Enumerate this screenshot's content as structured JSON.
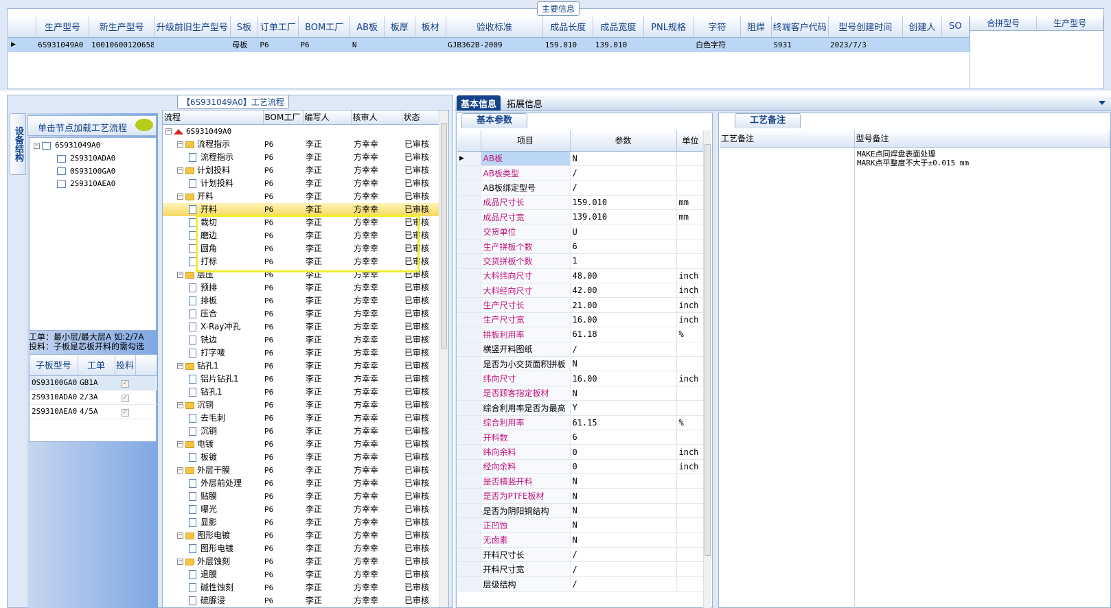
{
  "main_info": {
    "caption": "主要信息",
    "columns": [
      "生产型号",
      "新生产型号",
      "升级前旧生产型号",
      "S板",
      "订单工厂",
      "BOM工厂",
      "AB板",
      "板厚",
      "板材",
      "验收标准",
      "成品长度",
      "成品宽度",
      "PNL规格",
      "字符",
      "阻焊",
      "终端客户代码",
      "型号创建时间",
      "创建人",
      "SO"
    ],
    "row": [
      "6S931049A0",
      "10010600120658",
      "",
      "母板",
      "P6",
      "P6",
      "N",
      "",
      "",
      "GJB362B-2009",
      "159.010",
      "139.010",
      "",
      "白色字符",
      "",
      "S931",
      "2023/7/3",
      "",
      ""
    ],
    "merge_cols": [
      "合拼型号",
      "生产型号"
    ]
  },
  "process": {
    "caption": "【6S931049A0】工艺流程",
    "side_tab": "设备结构",
    "hint": "单击节点加载工艺流程",
    "left_tree": {
      "root": "6S931049A0",
      "children": [
        "2S9310ADA0",
        "0S93100GA0",
        "2S9310AEA0"
      ]
    },
    "note_line1": "工单：最小层/最大层A 如:2/7A",
    "note_line2": "投料：子板是芯板开料的需勾选",
    "sub_columns": [
      "子板型号",
      "工单",
      "投料"
    ],
    "sub_rows": [
      [
        "0S93100GA0",
        "GB1A"
      ],
      [
        "2S9310ADA0",
        "2/3A"
      ],
      [
        "2S9310AEA0",
        "4/5A"
      ]
    ],
    "tree_columns": [
      "流程",
      "BOM工厂",
      "编写人",
      "核审人",
      "状态"
    ],
    "tree_rows": [
      {
        "label": "6S931049A0",
        "level": 0,
        "kind": "root",
        "bom": "",
        "writer": "",
        "reviewer": "",
        "status": ""
      },
      {
        "label": "流程指示",
        "level": 1,
        "kind": "folder",
        "bom": "P6",
        "writer": "李正",
        "reviewer": "方幸幸",
        "status": "已审核"
      },
      {
        "label": "流程指示",
        "level": 2,
        "kind": "doc",
        "bom": "P6",
        "writer": "李正",
        "reviewer": "方幸幸",
        "status": "已审核"
      },
      {
        "label": "计划投料",
        "level": 1,
        "kind": "folder",
        "bom": "P6",
        "writer": "李正",
        "reviewer": "方幸幸",
        "status": "已审核"
      },
      {
        "label": "计划投料",
        "level": 2,
        "kind": "doc",
        "bom": "P6",
        "writer": "李正",
        "reviewer": "方幸幸",
        "status": "已审核"
      },
      {
        "label": "开料",
        "level": 1,
        "kind": "folder",
        "bom": "P6",
        "writer": "李正",
        "reviewer": "方幸幸",
        "status": "已审核"
      },
      {
        "label": "开料",
        "level": 2,
        "kind": "doc",
        "bom": "P6",
        "writer": "李正",
        "reviewer": "方幸幸",
        "status": "已审核",
        "selected": true
      },
      {
        "label": "裁切",
        "level": 2,
        "kind": "doc",
        "bom": "P6",
        "writer": "李正",
        "reviewer": "方幸幸",
        "status": "已审核"
      },
      {
        "label": "磨边",
        "level": 2,
        "kind": "doc",
        "bom": "P6",
        "writer": "李正",
        "reviewer": "方幸幸",
        "status": "已审核"
      },
      {
        "label": "圆角",
        "level": 2,
        "kind": "doc",
        "bom": "P6",
        "writer": "李正",
        "reviewer": "方幸幸",
        "status": "已审核"
      },
      {
        "label": "打标",
        "level": 2,
        "kind": "doc",
        "bom": "P6",
        "writer": "李正",
        "reviewer": "方幸幸",
        "status": "已审核"
      },
      {
        "label": "层压",
        "level": 1,
        "kind": "folder",
        "bom": "P6",
        "writer": "李正",
        "reviewer": "方幸幸",
        "status": "已审核"
      },
      {
        "label": "预排",
        "level": 2,
        "kind": "doc",
        "bom": "P6",
        "writer": "李正",
        "reviewer": "方幸幸",
        "status": "已审核"
      },
      {
        "label": "排板",
        "level": 2,
        "kind": "doc",
        "bom": "P6",
        "writer": "李正",
        "reviewer": "方幸幸",
        "status": "已审核"
      },
      {
        "label": "压合",
        "level": 2,
        "kind": "doc",
        "bom": "P6",
        "writer": "李正",
        "reviewer": "方幸幸",
        "status": "已审核"
      },
      {
        "label": "X-Ray冲孔",
        "level": 2,
        "kind": "doc",
        "bom": "P6",
        "writer": "李正",
        "reviewer": "方幸幸",
        "status": "已审核"
      },
      {
        "label": "铣边",
        "level": 2,
        "kind": "doc",
        "bom": "P6",
        "writer": "李正",
        "reviewer": "方幸幸",
        "status": "已审核"
      },
      {
        "label": "打字唛",
        "level": 2,
        "kind": "doc",
        "bom": "P6",
        "writer": "李正",
        "reviewer": "方幸幸",
        "status": "已审核"
      },
      {
        "label": "钻孔1",
        "level": 1,
        "kind": "folder",
        "bom": "P6",
        "writer": "李正",
        "reviewer": "方幸幸",
        "status": "已审核"
      },
      {
        "label": "铝片钻孔1",
        "level": 2,
        "kind": "doc",
        "bom": "P6",
        "writer": "李正",
        "reviewer": "方幸幸",
        "status": "已审核"
      },
      {
        "label": "钻孔1",
        "level": 2,
        "kind": "doc",
        "bom": "P6",
        "writer": "李正",
        "reviewer": "方幸幸",
        "status": "已审核"
      },
      {
        "label": "沉铜",
        "level": 1,
        "kind": "folder",
        "bom": "P6",
        "writer": "李正",
        "reviewer": "方幸幸",
        "status": "已审核"
      },
      {
        "label": "去毛刺",
        "level": 2,
        "kind": "doc",
        "bom": "P6",
        "writer": "李正",
        "reviewer": "方幸幸",
        "status": "已审核"
      },
      {
        "label": "沉铜",
        "level": 2,
        "kind": "doc",
        "bom": "P6",
        "writer": "李正",
        "reviewer": "方幸幸",
        "status": "已审核"
      },
      {
        "label": "电镀",
        "level": 1,
        "kind": "folder",
        "bom": "P6",
        "writer": "李正",
        "reviewer": "方幸幸",
        "status": "已审核"
      },
      {
        "label": "板镀",
        "level": 2,
        "kind": "doc",
        "bom": "P6",
        "writer": "李正",
        "reviewer": "方幸幸",
        "status": "已审核"
      },
      {
        "label": "外层干膜",
        "level": 1,
        "kind": "folder",
        "bom": "P6",
        "writer": "李正",
        "reviewer": "方幸幸",
        "status": "已审核"
      },
      {
        "label": "外层前处理",
        "level": 2,
        "kind": "doc",
        "bom": "P6",
        "writer": "李正",
        "reviewer": "方幸幸",
        "status": "已审核"
      },
      {
        "label": "贴膜",
        "level": 2,
        "kind": "doc",
        "bom": "P6",
        "writer": "李正",
        "reviewer": "方幸幸",
        "status": "已审核"
      },
      {
        "label": "曝光",
        "level": 2,
        "kind": "doc",
        "bom": "P6",
        "writer": "李正",
        "reviewer": "方幸幸",
        "status": "已审核"
      },
      {
        "label": "显影",
        "level": 2,
        "kind": "doc",
        "bom": "P6",
        "writer": "李正",
        "reviewer": "方幸幸",
        "status": "已审核"
      },
      {
        "label": "图形电镀",
        "level": 1,
        "kind": "folder",
        "bom": "P6",
        "writer": "李正",
        "reviewer": "方幸幸",
        "status": "已审核"
      },
      {
        "label": "图形电镀",
        "level": 2,
        "kind": "doc",
        "bom": "P6",
        "writer": "李正",
        "reviewer": "方幸幸",
        "status": "已审核"
      },
      {
        "label": "外层蚀刻",
        "level": 1,
        "kind": "folder",
        "bom": "P6",
        "writer": "李正",
        "reviewer": "方幸幸",
        "status": "已审核"
      },
      {
        "label": "退膜",
        "level": 2,
        "kind": "doc",
        "bom": "P6",
        "writer": "李正",
        "reviewer": "方幸幸",
        "status": "已审核"
      },
      {
        "label": "碱性蚀刻",
        "level": 2,
        "kind": "doc",
        "bom": "P6",
        "writer": "李正",
        "reviewer": "方幸幸",
        "status": "已审核"
      },
      {
        "label": "硫脲浸",
        "level": 2,
        "kind": "doc",
        "bom": "P6",
        "writer": "李正",
        "reviewer": "方幸幸",
        "status": "已审核"
      }
    ]
  },
  "right": {
    "tabs": [
      "基本信息",
      "拓展信息"
    ],
    "subtab": "基本参数",
    "param_columns": [
      "项目",
      "参数",
      "单位"
    ],
    "params": [
      {
        "name": "AB板",
        "value": "N",
        "unit": "",
        "pink": true
      },
      {
        "name": "AB板类型",
        "value": "/",
        "unit": "",
        "pink": true
      },
      {
        "name": "AB板绑定型号",
        "value": "/",
        "unit": "",
        "pink": false
      },
      {
        "name": "成品尺寸长",
        "value": "159.010",
        "unit": "mm",
        "pink": true
      },
      {
        "name": "成品尺寸宽",
        "value": "139.010",
        "unit": "mm",
        "pink": true
      },
      {
        "name": "交货单位",
        "value": "U",
        "unit": "",
        "pink": true
      },
      {
        "name": "生产拼板个数",
        "value": "6",
        "unit": "",
        "pink": true
      },
      {
        "name": "交货拼板个数",
        "value": "1",
        "unit": "",
        "pink": true
      },
      {
        "name": "大料纬向尺寸",
        "value": "48.00",
        "unit": "inch",
        "pink": true
      },
      {
        "name": "大料经向尺寸",
        "value": "42.00",
        "unit": "inch",
        "pink": true
      },
      {
        "name": "生产尺寸长",
        "value": "21.00",
        "unit": "inch",
        "pink": true
      },
      {
        "name": "生产尺寸宽",
        "value": "16.00",
        "unit": "inch",
        "pink": true
      },
      {
        "name": "拼板利用率",
        "value": "61.18",
        "unit": "%",
        "pink": true
      },
      {
        "name": "横竖开料图纸",
        "value": "/",
        "unit": "",
        "pink": false
      },
      {
        "name": "是否为小交货面积拼板",
        "value": "N",
        "unit": "",
        "pink": false
      },
      {
        "name": "纬向尺寸",
        "value": "16.00",
        "unit": "inch",
        "pink": true
      },
      {
        "name": "是否顾客指定板材",
        "value": "N",
        "unit": "",
        "pink": true
      },
      {
        "name": "综合利用率是否为最高",
        "value": "Y",
        "unit": "",
        "pink": false
      },
      {
        "name": "综合利用率",
        "value": "61.15",
        "unit": "%",
        "pink": true
      },
      {
        "name": "开料数",
        "value": "6",
        "unit": "",
        "pink": true
      },
      {
        "name": "纬向余料",
        "value": "0",
        "unit": "inch",
        "pink": true
      },
      {
        "name": "经向余料",
        "value": "0",
        "unit": "inch",
        "pink": true
      },
      {
        "name": "是否横竖开料",
        "value": "N",
        "unit": "",
        "pink": true
      },
      {
        "name": "是否为PTFE板材",
        "value": "N",
        "unit": "",
        "pink": true
      },
      {
        "name": "是否为阴阳铜结构",
        "value": "N",
        "unit": "",
        "pink": false
      },
      {
        "name": "正凹蚀",
        "value": "N",
        "unit": "",
        "pink": true
      },
      {
        "name": "无卤素",
        "value": "N",
        "unit": "",
        "pink": true
      },
      {
        "name": "开料尺寸长",
        "value": "/",
        "unit": "",
        "pink": false
      },
      {
        "name": "开料尺寸宽",
        "value": "/",
        "unit": "",
        "pink": false
      },
      {
        "name": "层级结构",
        "value": "/",
        "unit": "",
        "pink": false
      }
    ],
    "remark_tab": "工艺备注",
    "remark_columns": [
      "工艺备注",
      "型号备注"
    ],
    "remark_line1": "MAKE点同焊盘表面处理",
    "remark_line2": "MARK点平整度不大于±0.015 mm"
  }
}
